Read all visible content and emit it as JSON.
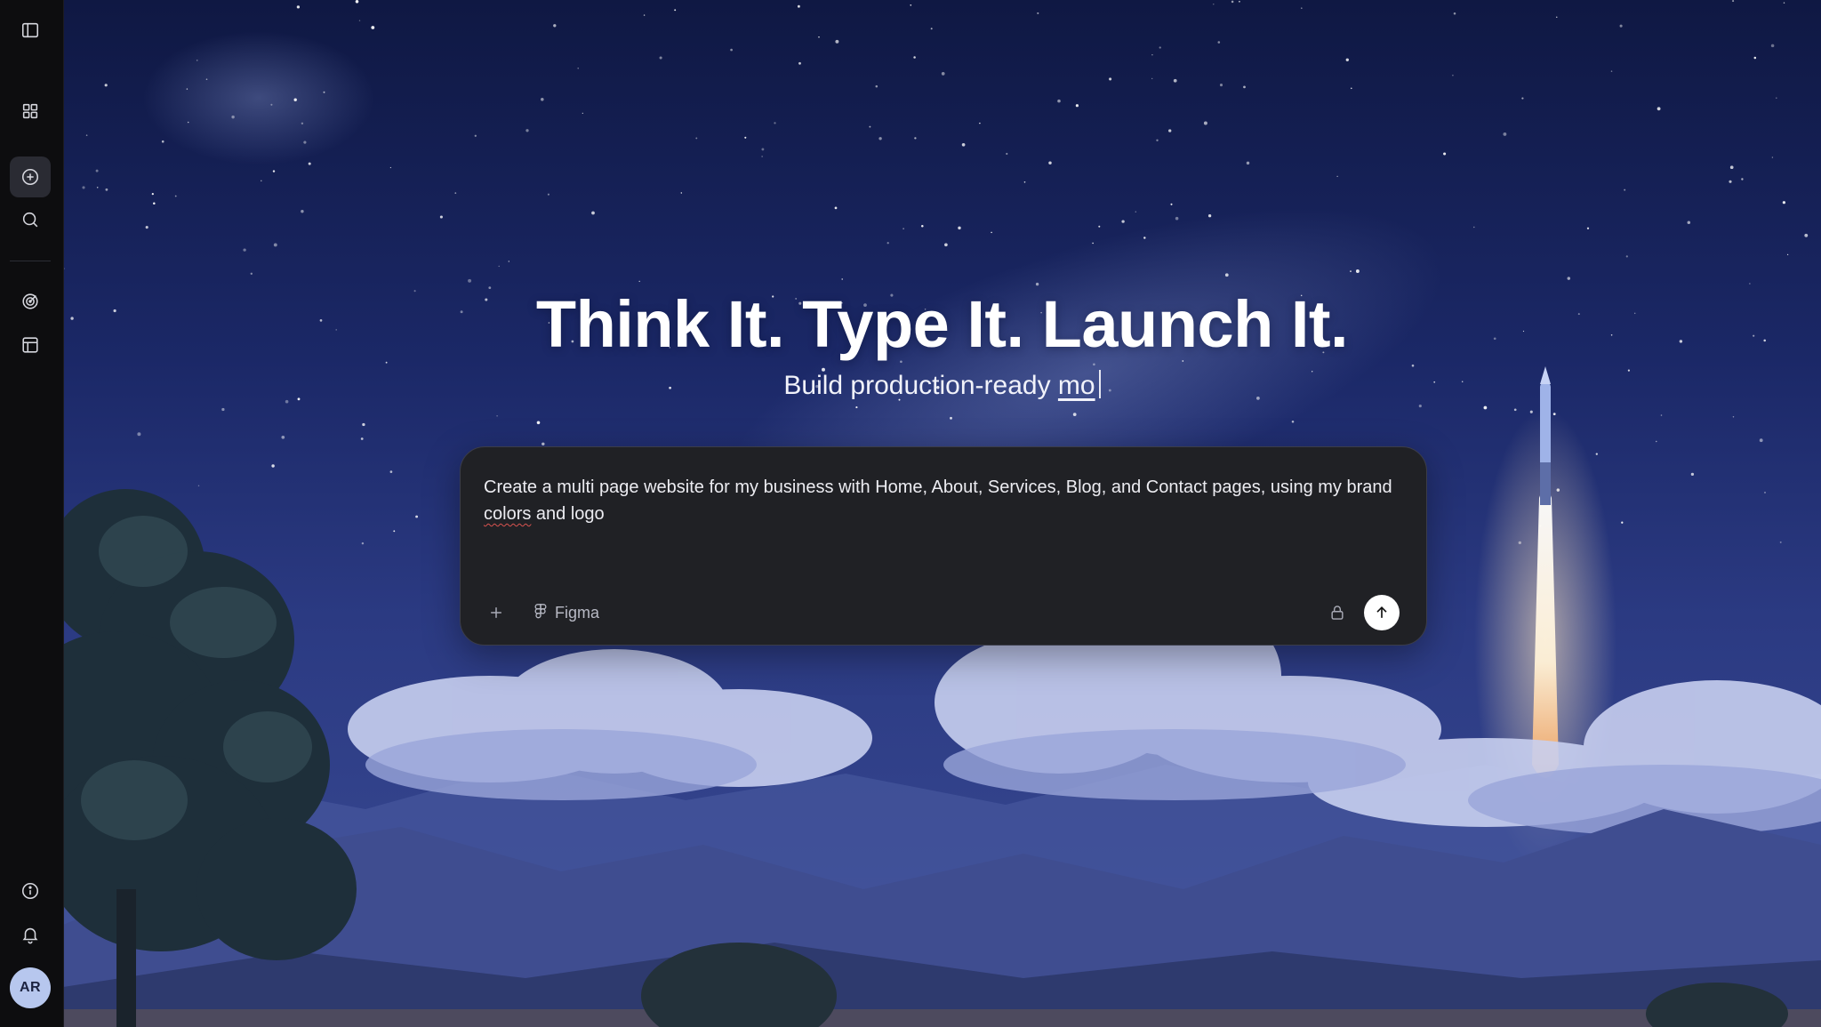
{
  "sidebar": {
    "items": [
      {
        "icon": "sidebar-toggle-icon"
      },
      {
        "icon": "grid-icon"
      },
      {
        "icon": "plus-circle-icon"
      },
      {
        "icon": "search-icon"
      },
      {
        "icon": "target-icon"
      },
      {
        "icon": "layout-icon"
      },
      {
        "icon": "info-icon"
      },
      {
        "icon": "bell-icon"
      }
    ],
    "avatar_initials": "AR"
  },
  "hero": {
    "title": "Think It. Type It. Launch It.",
    "subtitle_prefix": "Build production-ready",
    "subtitle_typed": "mo"
  },
  "prompt": {
    "text_part1": "Create a multi page website for my business with Home, About, Services, Blog, and Contact pages, using my brand ",
    "text_spell": "colors",
    "text_part2": " and logo",
    "figma_label": "Figma"
  },
  "colors": {
    "sidebar_bg": "#0d0d0f",
    "prompt_bg": "#202125",
    "send_button_bg": "#ffffff",
    "night_sky": "#15205a"
  }
}
